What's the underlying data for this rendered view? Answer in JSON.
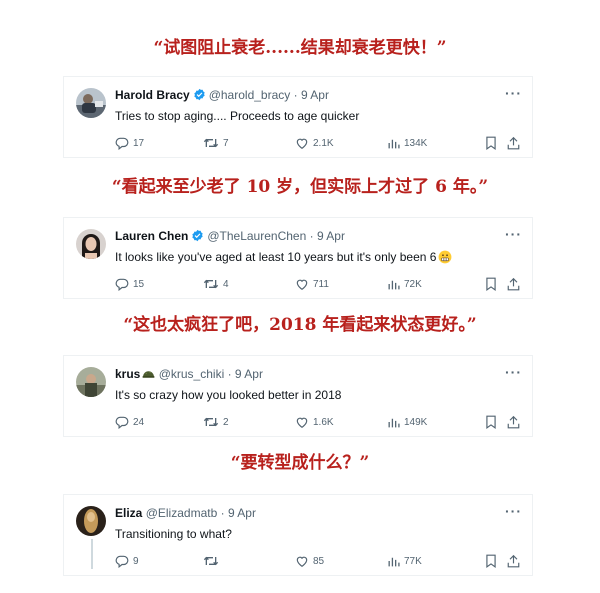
{
  "captions": [
    "“试图阻止衰老......结果却衰老更快！”",
    "“看起来至少老了 10 岁，但实际上才过了 6 年。”",
    "“这也太疯狂了吧，2018 年看起来状态更好。”",
    "“要转型成什么？”"
  ],
  "tweets": [
    {
      "name": "Harold Bracy",
      "verified": true,
      "handle": "@harold_bracy",
      "separator": "·",
      "date": "9 Apr",
      "text": "Tries to stop aging.... Proceeds to age quicker",
      "replies": "17",
      "retweets": "7",
      "likes": "2.1K",
      "views": "134K",
      "avatar_color": "#6f7a86"
    },
    {
      "name": "Lauren Chen",
      "verified": true,
      "handle": "@TheLaurenChen",
      "separator": "·",
      "date": "9 Apr",
      "text": "It looks like you've aged at least 10 years but it's only been 6",
      "replies": "15",
      "retweets": "4",
      "likes": "711",
      "views": "72K",
      "avatar_color": "#2b2321"
    },
    {
      "name": "krus",
      "verified": false,
      "handle": "@krus_chiki",
      "separator": "·",
      "date": "9 Apr",
      "text": "It's so crazy how you looked better in 2018",
      "replies": "24",
      "retweets": "2",
      "likes": "1.6K",
      "views": "149K",
      "avatar_color": "#8a8f7a"
    },
    {
      "name": "Eliza",
      "verified": false,
      "handle": "@Elizadmatb",
      "separator": "·",
      "date": "9 Apr",
      "text": "Transitioning to what?",
      "replies": "9",
      "retweets": "",
      "likes": "85",
      "views": "77K",
      "avatar_color": "#8a6a3e"
    }
  ],
  "icons": {
    "reply": "reply-icon",
    "retweet": "retweet-icon",
    "like": "heart-icon",
    "views": "views-icon",
    "bookmark": "bookmark-icon",
    "share": "share-icon",
    "more": "more-icon",
    "verified": "verified-badge-icon"
  },
  "colors": {
    "caption": "#b8211d",
    "verified": "#1d9bf0",
    "muted": "#536471"
  }
}
